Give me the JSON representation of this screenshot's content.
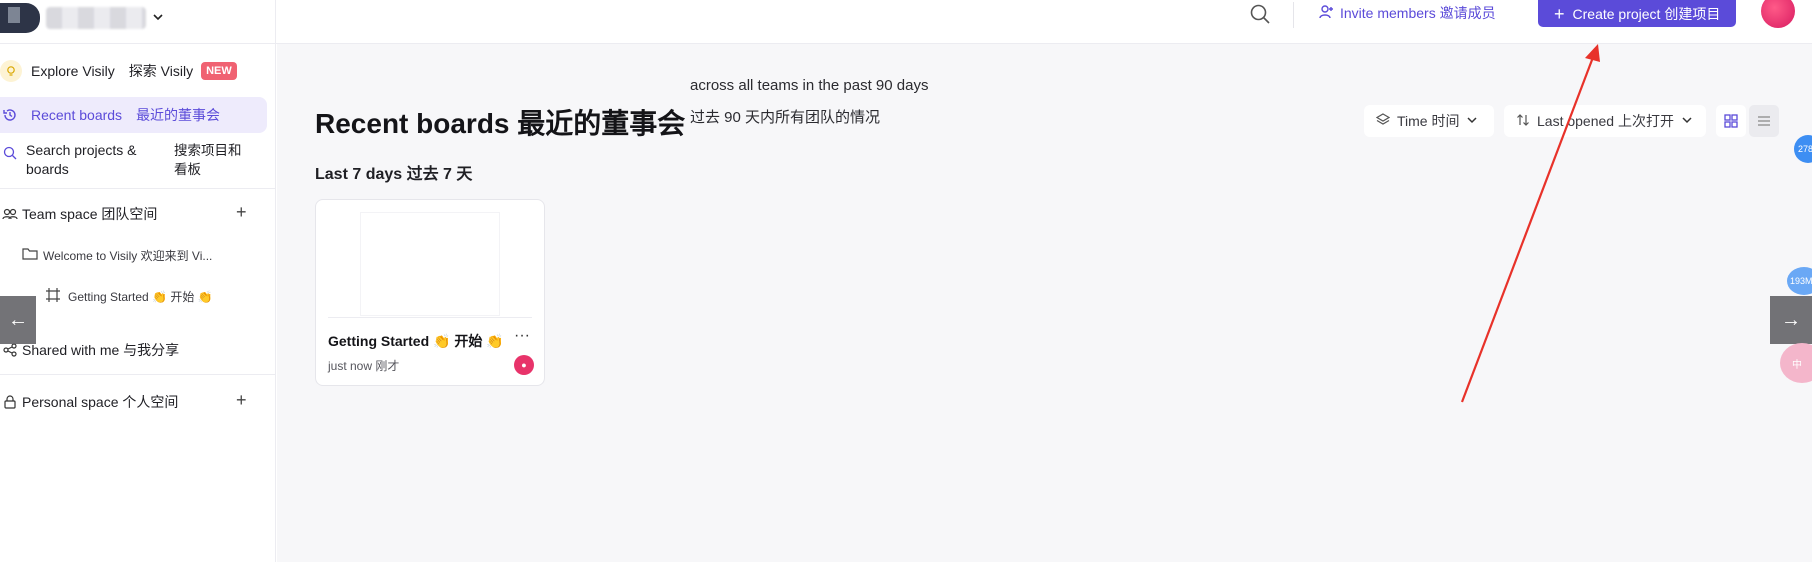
{
  "header": {
    "invite_label": "Invite members 邀请成员",
    "create_label": "Create project 创建项目"
  },
  "sidebar": {
    "explore_label": "Explore Visily",
    "explore_cn": "探索 Visily",
    "new_badge": "NEW",
    "recent_label": "Recent boards",
    "recent_cn": "最近的董事会",
    "search_label": "Search projects & boards",
    "search_cn": "搜索项目和看板",
    "team_label": "Team space 团队空间",
    "welcome_label": "Welcome to Visily 欢迎来到 Vi...",
    "getting_started_label": "Getting Started 👏 开始 👏",
    "shared_label": "Shared with me 与我分享",
    "personal_label": "Personal space 个人空间"
  },
  "main": {
    "page_title": "Recent boards 最近的董事会",
    "tooltip_line1": "across all teams in the past 90 days",
    "tooltip_line2": "过去 90 天内所有团队的情况",
    "section_heading": "Last 7 days 过去 7 天",
    "filter_time": "Time 时间",
    "filter_sort": "Last opened 上次打开",
    "card": {
      "title": "Getting Started 👏 开始 👏",
      "time": "just now 刚才"
    }
  },
  "floating": {
    "badge_1": "278",
    "badge_2": "193M",
    "badge_3": "中"
  },
  "colors": {
    "accent": "#5b4bd9",
    "accent_soft": "#eeebfc",
    "new_badge": "#f06272",
    "annotation_arrow": "#e8322a"
  },
  "icons": [
    "chevron-down-icon",
    "search-icon",
    "invite-icon",
    "plus-icon",
    "bulb-icon",
    "history-icon",
    "team-icon",
    "folder-icon",
    "frame-icon",
    "share-icon",
    "lock-icon",
    "layers-icon",
    "sort-icon",
    "grid-view-icon",
    "list-view-icon",
    "more-icon",
    "arrow-left-icon",
    "arrow-right-icon"
  ]
}
